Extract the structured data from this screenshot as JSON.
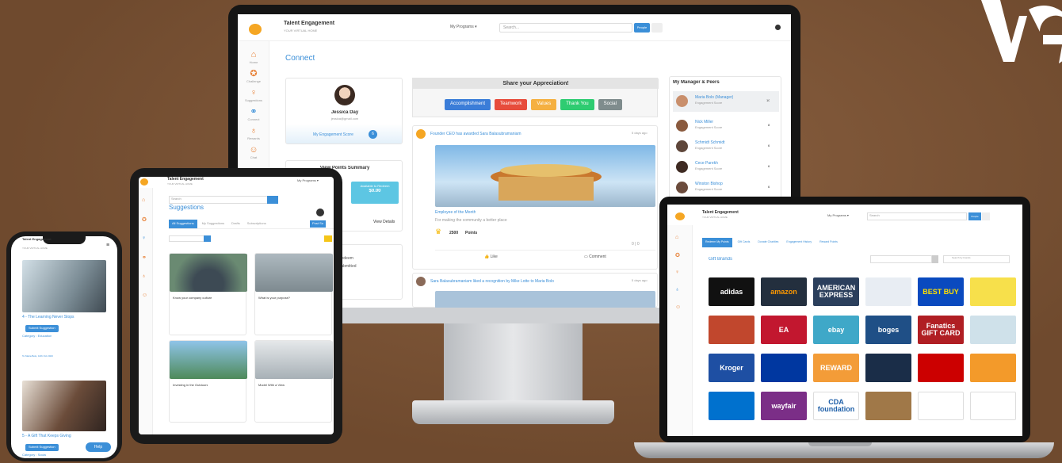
{
  "brand": {
    "logo_text": "VG"
  },
  "monitor": {
    "app_title": "Talent Engagement",
    "app_subtitle": "YOUR VIRTUAL HOME",
    "programs_label": "My Programs ▾",
    "search_placeholder": "Search...",
    "people_label": "People",
    "sidebar": [
      "Home",
      "Challenge",
      "Suggestions",
      "Connect",
      "Rewards",
      "Chat"
    ],
    "page_title": "Connect",
    "profile": {
      "name": "Jessica Day",
      "email": "jessica@gmail.com",
      "score_label": "My Engagement Score",
      "score_value": "6"
    },
    "points_summary": {
      "title": "View Points Summary",
      "available_label": "Available to Redeem",
      "available_value": "$0.00",
      "view_details": "View Details"
    },
    "redeem_rows": [
      "Redeem",
      "Submitted"
    ],
    "appreciation": {
      "title": "Share your Appreciation!",
      "tags": [
        {
          "label": "Accomplishment",
          "color": "#3b7dd8"
        },
        {
          "label": "Teamwork",
          "color": "#e74c3c"
        },
        {
          "label": "Values",
          "color": "#f5b041"
        },
        {
          "label": "Thank You",
          "color": "#2ecc71"
        },
        {
          "label": "Social",
          "color": "#7f8c8d"
        }
      ]
    },
    "post1": {
      "author_line": "Founder CEO has awarded Sara Balasubramaniam",
      "time": "5 days ago",
      "category": "Employee of the Month",
      "desc": "For making the community a better place",
      "points": "2500",
      "points_label": "Points",
      "like_label": "Like",
      "comment_label": "Comment",
      "counts": "0 | 0"
    },
    "post2": {
      "author_line": "Sara Balasubramaniam liked a recognition by Mike Lotte to Maria Bolo",
      "time": "5 days ago"
    },
    "managers": {
      "title": "My Manager & Peers",
      "list": [
        {
          "name": "Maria Bolo (Manager)",
          "sub": "Engagement Score",
          "score": "10"
        },
        {
          "name": "Nick Miller",
          "sub": "Engagement Score",
          "score": "8"
        },
        {
          "name": "Schmidt Schmidt",
          "sub": "Engagement Score",
          "score": "6"
        },
        {
          "name": "Cece Parekh",
          "sub": "Engagement Score",
          "score": "6"
        },
        {
          "name": "Winston Bishop",
          "sub": "Engagement Score",
          "score": "6"
        }
      ]
    }
  },
  "tablet": {
    "app_title": "Talent Engagement",
    "app_subtitle": "YOUR VIRTUAL HOME",
    "programs_label": "My Programs ▾",
    "search_label": "Search",
    "page_title": "Suggestions",
    "tabs": [
      "All Suggestions",
      "My Suggestions",
      "Drafts",
      "Subscriptions"
    ],
    "post_btn": "Post Su",
    "cards": [
      {
        "title": "Know your company culture"
      },
      {
        "title": "What is your purpose?"
      },
      {
        "title": "Investing in the Outdoors"
      },
      {
        "title": "Model With a View"
      }
    ]
  },
  "phone": {
    "app_title": "Talent Engagement",
    "app_subtitle": "YOUR VIRTUAL HOME",
    "item1": {
      "title": "4 - The Learning Never Stops",
      "button": "Submit Suggestion",
      "category": "Category : Education",
      "author": "To Maria Bolo, 10th Oct 2023"
    },
    "item2": {
      "title": "5 - A Gift That Keeps Giving",
      "button": "Submit Suggestion",
      "category": "Category : Social"
    },
    "help_label": "Help"
  },
  "laptop": {
    "app_title": "Talent Engagement",
    "app_subtitle": "YOUR VIRTUAL HOME",
    "programs_label": "My Programs ▾",
    "search_placeholder": "Search",
    "people_label": "People",
    "tabs": [
      "Redeem My Points",
      "Gift Cards",
      "Donate Charities",
      "Engagement History",
      "Reward Points"
    ],
    "section_title": "Gift Brands",
    "search_filter": "Search by brands",
    "brands": [
      {
        "label": "adidas",
        "bg": "#111111",
        "fg": "#ffffff"
      },
      {
        "label": "amazon",
        "bg": "#232f3e",
        "fg": "#ff9900"
      },
      {
        "label": "AMERICAN EXPRESS",
        "bg": "#2b3f5c",
        "fg": "#ffffff"
      },
      {
        "label": "",
        "bg": "#e8edf3",
        "fg": "#333333"
      },
      {
        "label": "BEST BUY",
        "bg": "#0a4abf",
        "fg": "#ffe000"
      },
      {
        "label": "",
        "bg": "#f7e04b",
        "fg": "#333333"
      },
      {
        "label": "",
        "bg": "#c1472d",
        "fg": "#ffffff"
      },
      {
        "label": "EA",
        "bg": "#c2172f",
        "fg": "#ffffff"
      },
      {
        "label": "ebay",
        "bg": "#3fa8c8",
        "fg": "#ffffff"
      },
      {
        "label": "boges",
        "bg": "#1f4f86",
        "fg": "#ffffff"
      },
      {
        "label": "Fanatics GIFT CARD",
        "bg": "#b01e23",
        "fg": "#ffffff"
      },
      {
        "label": "",
        "bg": "#cfe1ea",
        "fg": "#c41e3a"
      },
      {
        "label": "Kroger",
        "bg": "#1e4fa3",
        "fg": "#ffffff"
      },
      {
        "label": "",
        "bg": "#0037a0",
        "fg": "#ffffff"
      },
      {
        "label": "REWARD",
        "bg": "#f39c38",
        "fg": "#ffffff"
      },
      {
        "label": "",
        "bg": "#1a2d48",
        "fg": "#ffffff"
      },
      {
        "label": "",
        "bg": "#cc0000",
        "fg": "#ffffff"
      },
      {
        "label": "",
        "bg": "#f39a2a",
        "fg": "#ffffff"
      },
      {
        "label": "",
        "bg": "#0071ce",
        "fg": "#ffc220"
      },
      {
        "label": "wayfair",
        "bg": "#7b2e87",
        "fg": "#ffffff"
      },
      {
        "label": "CDA foundation",
        "bg": "#ffffff",
        "fg": "#1e5fa8"
      },
      {
        "label": "",
        "bg": "#a07848",
        "fg": "#ffffff"
      },
      {
        "label": "",
        "bg": "#ffffff",
        "fg": "#e27a1e"
      },
      {
        "label": "",
        "bg": "#ffffff",
        "fg": "#c41e3a"
      }
    ]
  }
}
